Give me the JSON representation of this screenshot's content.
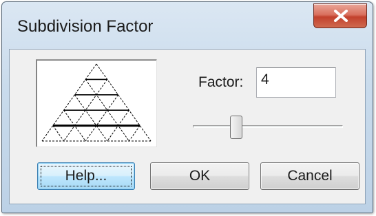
{
  "window": {
    "title": "Subdivision Factor",
    "close_icon": "close-x-icon"
  },
  "preview": {
    "icon": "subdivided-triangle-preview",
    "subdivision_factor": 4
  },
  "factor": {
    "label": "Factor:",
    "value": "4"
  },
  "slider": {
    "level_fraction": 0.27
  },
  "buttons": {
    "help_label": "Help...",
    "ok_label": "OK",
    "cancel_label": "Cancel"
  },
  "colors": {
    "close_button": "#c9503c",
    "focus_button_border": "#3c7fb1",
    "client_background": "#f0f0f0"
  }
}
